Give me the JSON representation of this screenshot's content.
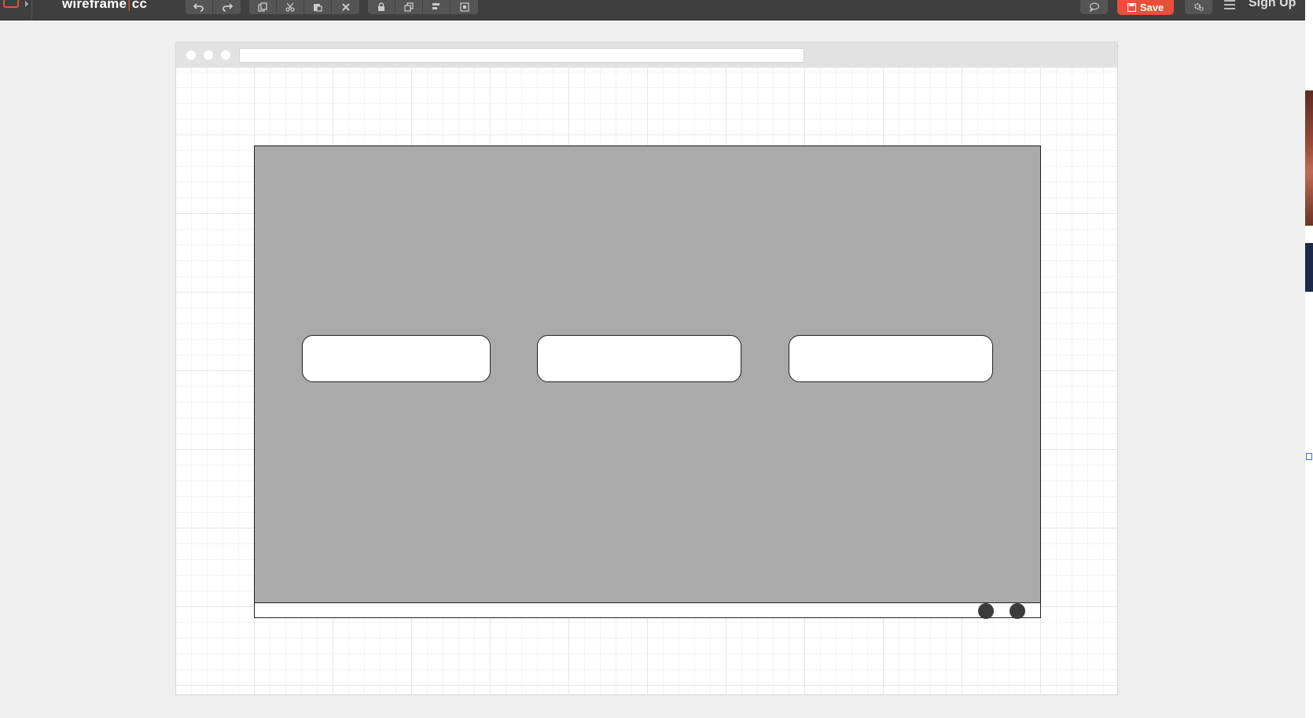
{
  "app": {
    "logo_left": "wireframe",
    "logo_sep": "|",
    "logo_right": "cc"
  },
  "toolbar": {
    "history": [
      {
        "icon": "undo-icon"
      },
      {
        "icon": "redo-icon"
      }
    ],
    "edit": [
      {
        "icon": "copy-icon"
      },
      {
        "icon": "cut-icon"
      },
      {
        "icon": "paste-icon"
      },
      {
        "icon": "delete-icon"
      }
    ],
    "arrange": [
      {
        "icon": "lock-icon"
      },
      {
        "icon": "duplicate-icon"
      },
      {
        "icon": "align-left-icon"
      },
      {
        "icon": "align-center-icon"
      }
    ],
    "save_label": "Save",
    "signup_label": "Sign Up"
  },
  "canvas": {
    "browser_mock": {
      "address_text": ""
    },
    "carousel": {
      "cards": 3,
      "indicators": 2
    }
  },
  "colors": {
    "toolbar_bg": "#3f3f3f",
    "accent": "#e8503a",
    "carousel_image": "#aaaaaa"
  }
}
